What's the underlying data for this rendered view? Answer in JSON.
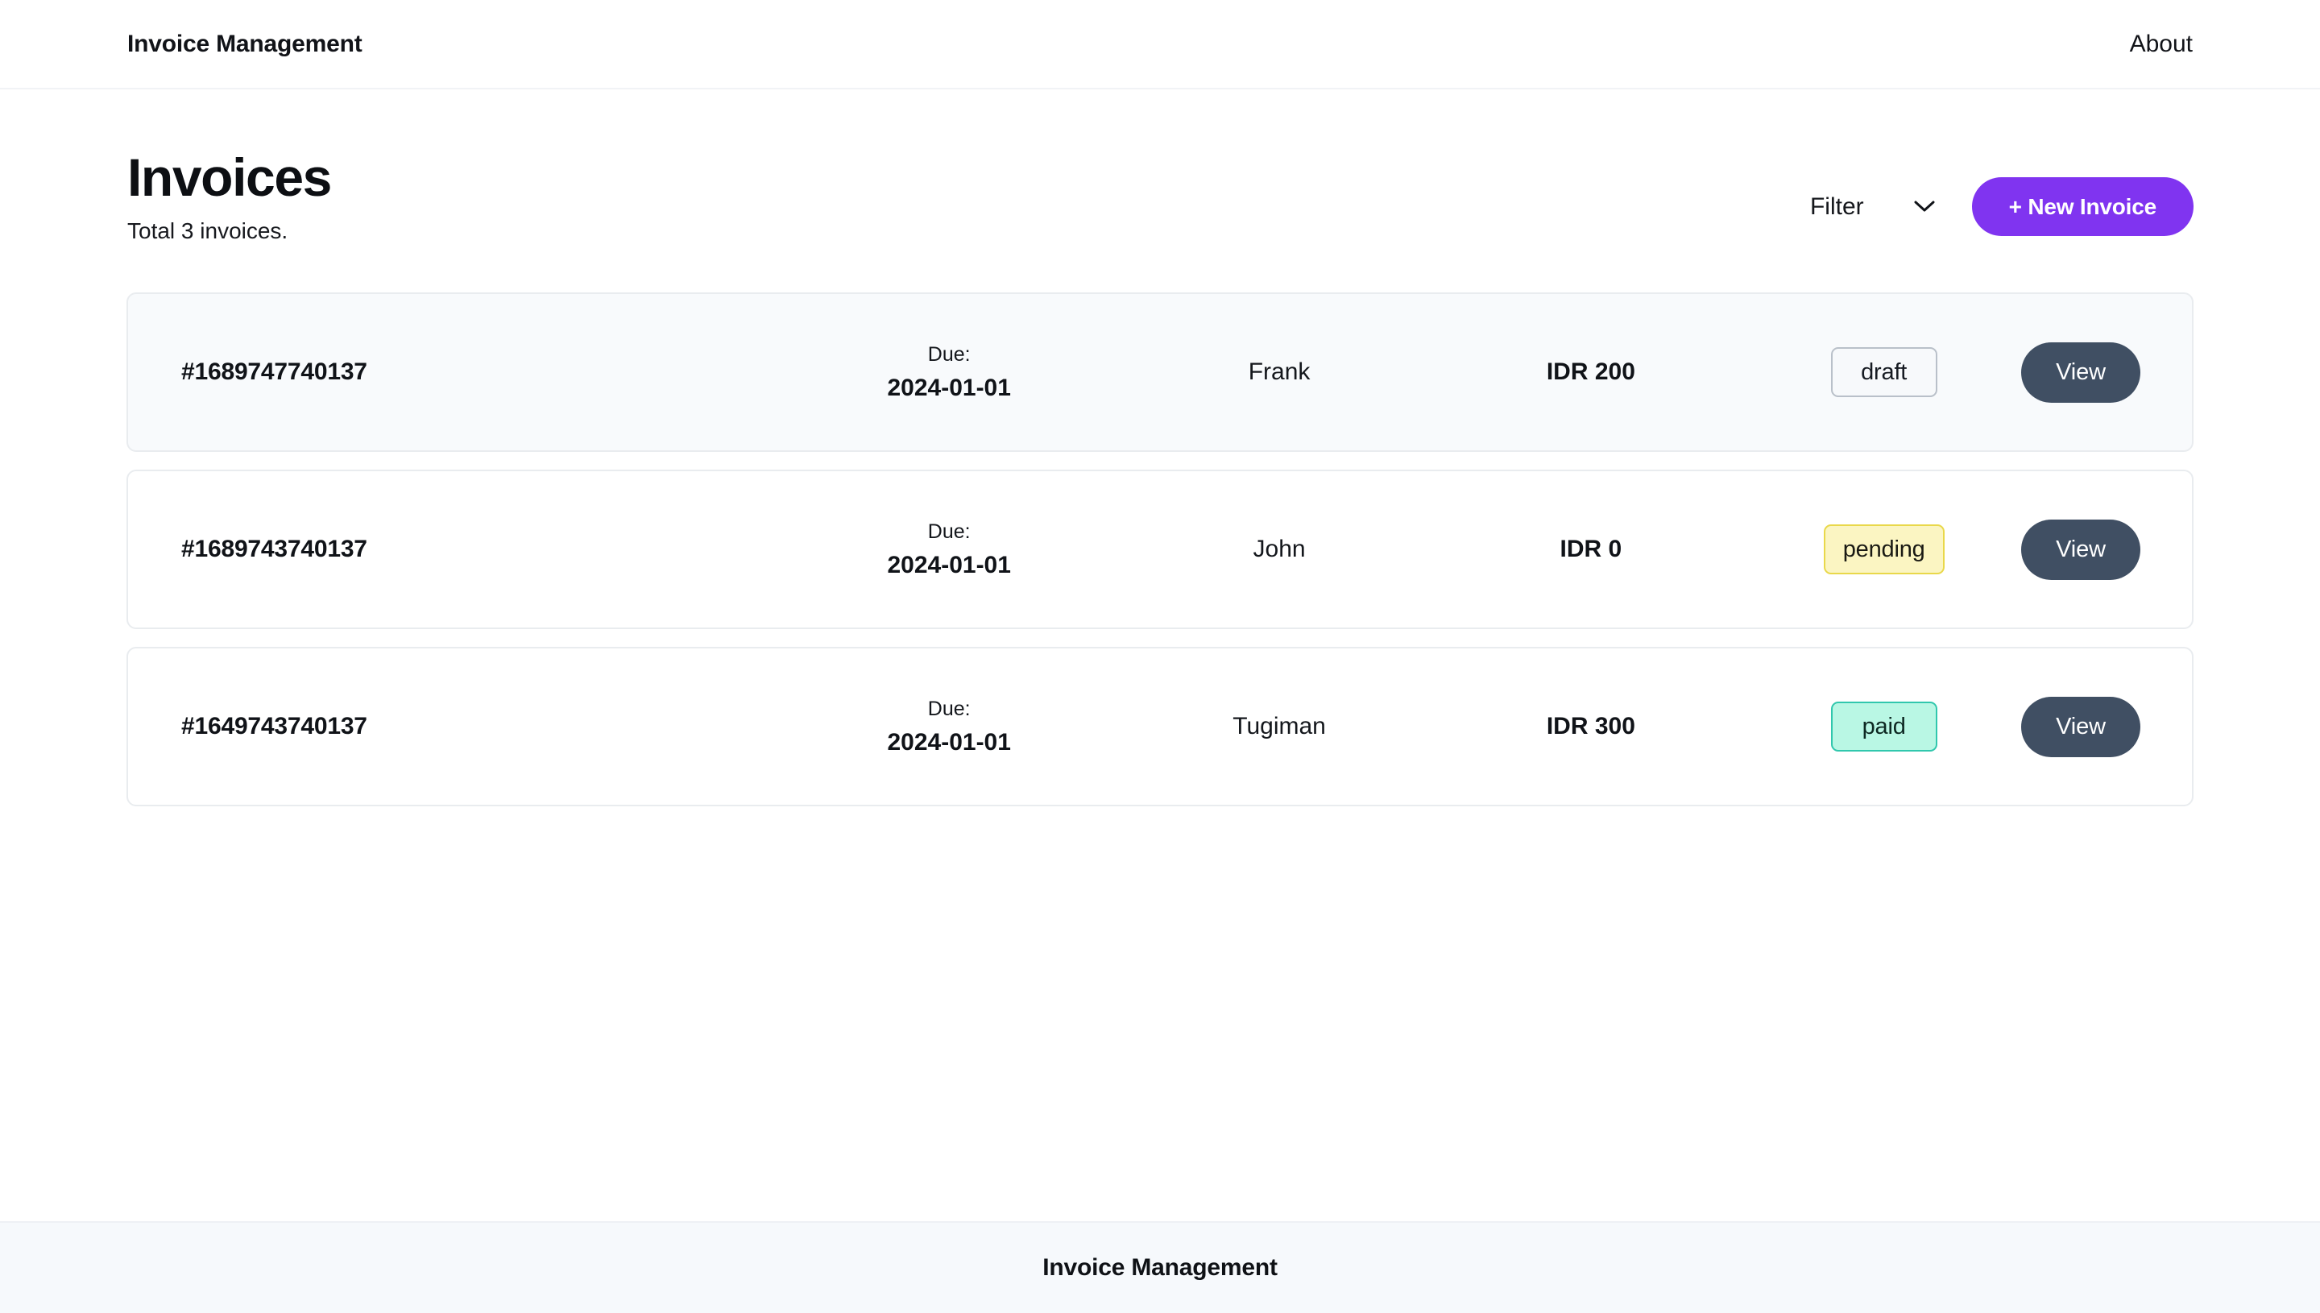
{
  "navbar": {
    "brand": "Invoice Management",
    "links": [
      {
        "label": "About",
        "name": "about"
      }
    ]
  },
  "page": {
    "title": "Invoices",
    "subtitle": "Total 3 invoices."
  },
  "actions": {
    "filter_label": "Filter",
    "filter_icon": "chevron-down-icon",
    "new_invoice_label": "+ New Invoice",
    "accent_color": "#8034f0"
  },
  "table": {
    "due_label": "Due:",
    "view_label": "View",
    "rows": [
      {
        "id": "#1689747740137",
        "due_label": "Due:",
        "due_date": "2024-01-01",
        "client": "Frank",
        "amount": "IDR 200",
        "status": "draft",
        "status_variant": "draft",
        "view_label": "View",
        "highlighted": true
      },
      {
        "id": "#1689743740137",
        "due_label": "Due:",
        "due_date": "2024-01-01",
        "client": "John",
        "amount": "IDR 0",
        "status": "pending",
        "status_variant": "pending",
        "view_label": "View",
        "highlighted": false
      },
      {
        "id": "#1649743740137",
        "due_label": "Due:",
        "due_date": "2024-01-01",
        "client": "Tugiman",
        "amount": "IDR 300",
        "status": "paid",
        "status_variant": "paid",
        "view_label": "View",
        "highlighted": false
      }
    ]
  },
  "footer": {
    "text": "Invoice Management"
  }
}
